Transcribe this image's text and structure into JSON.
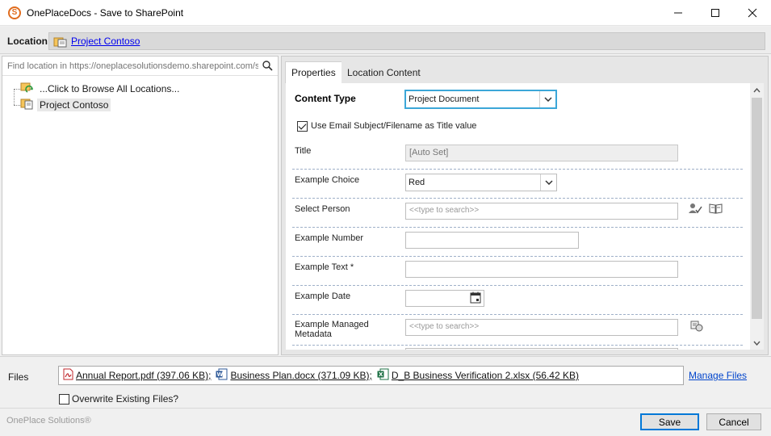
{
  "window": {
    "title": "OnePlaceDocs - Save to SharePoint",
    "minimize_glyph": "—",
    "maximize_glyph": "☐",
    "close_glyph": "✕"
  },
  "location": {
    "label": "Location",
    "value": "Project Contoso"
  },
  "left": {
    "find_placeholder": "Find location in https://oneplacesolutionsdemo.sharepoint.com/sites",
    "tree": [
      {
        "label": "...Click to Browse All Locations...",
        "icon": "browse-locations-icon"
      },
      {
        "label": "Project Contoso",
        "icon": "site-folder-icon",
        "selected": true
      }
    ]
  },
  "tabs": [
    {
      "label": "Properties",
      "active": true
    },
    {
      "label": "Location Content",
      "active": false
    }
  ],
  "form": {
    "content_type_label": "Content Type",
    "content_type_value": "Project Document",
    "use_email_subject_label": "Use Email Subject/Filename as Title value",
    "use_email_subject_checked": true,
    "title_label": "Title",
    "title_value": "[Auto Set]",
    "choice_label": "Example Choice",
    "choice_value": "Red",
    "person_label": "Select Person",
    "person_placeholder": "<<type to search>>",
    "number_label": "Example Number",
    "number_value": "",
    "text_label": "Example Text *",
    "text_value": "",
    "date_label": "Example Date",
    "date_value": "",
    "metadata_label_1": "Example Managed",
    "metadata_label_2": "Metadata",
    "metadata_placeholder": "<<type to search>>"
  },
  "files": {
    "label": "Files",
    "items": [
      {
        "name": "Annual Report.pdf (397.06 KB);",
        "icon": "pdf-icon"
      },
      {
        "name": "Business Plan.docx (371.09 KB);",
        "icon": "word-icon"
      },
      {
        "name": "D_B Business Verification 2.xlsx (56.42 KB)",
        "icon": "excel-icon"
      }
    ],
    "manage_label": "Manage Files",
    "overwrite_label": "Overwrite Existing Files?",
    "overwrite_checked": false
  },
  "footer": {
    "brand": "OnePlace Solutions®",
    "save_label": "Save",
    "cancel_label": "Cancel"
  },
  "colors": {
    "accent_focus": "#3ca7d8",
    "primary_button_border": "#0078d7",
    "link": "#0000ee",
    "separator": "#9fb0c8"
  }
}
